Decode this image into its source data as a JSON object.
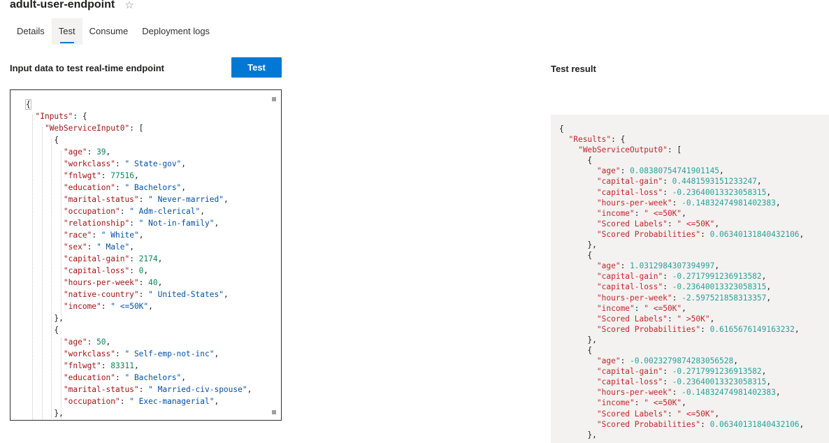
{
  "header": {
    "title": "adult-user-endpoint",
    "favorite_icon": "star-outline-icon"
  },
  "tabs": [
    {
      "label": "Details",
      "selected": false
    },
    {
      "label": "Test",
      "selected": true
    },
    {
      "label": "Consume",
      "selected": false
    },
    {
      "label": "Deployment logs",
      "selected": false
    }
  ],
  "input_section": {
    "label": "Input data to test real-time endpoint",
    "button_label": "Test"
  },
  "result_section": {
    "label": "Test result"
  },
  "input_json": {
    "root_key": "Inputs",
    "array_key": "WebServiceInput0",
    "records": [
      [
        {
          "key": "age",
          "value": "39",
          "type": "num"
        },
        {
          "key": "workclass",
          "value": " State-gov",
          "type": "str"
        },
        {
          "key": "fnlwgt",
          "value": "77516",
          "type": "num"
        },
        {
          "key": "education",
          "value": " Bachelors",
          "type": "str"
        },
        {
          "key": "marital-status",
          "value": " Never-married",
          "type": "str"
        },
        {
          "key": "occupation",
          "value": " Adm-clerical",
          "type": "str"
        },
        {
          "key": "relationship",
          "value": " Not-in-family",
          "type": "str"
        },
        {
          "key": "race",
          "value": " White",
          "type": "str"
        },
        {
          "key": "sex",
          "value": " Male",
          "type": "str"
        },
        {
          "key": "capital-gain",
          "value": "2174",
          "type": "num"
        },
        {
          "key": "capital-loss",
          "value": "0",
          "type": "num"
        },
        {
          "key": "hours-per-week",
          "value": "40",
          "type": "num"
        },
        {
          "key": "native-country",
          "value": " United-States",
          "type": "str"
        },
        {
          "key": "income",
          "value": " <=50K",
          "type": "str"
        }
      ],
      [
        {
          "key": "age",
          "value": "50",
          "type": "num"
        },
        {
          "key": "workclass",
          "value": " Self-emp-not-inc",
          "type": "str"
        },
        {
          "key": "fnlwgt",
          "value": "83311",
          "type": "num"
        },
        {
          "key": "education",
          "value": " Bachelors",
          "type": "str"
        },
        {
          "key": "marital-status",
          "value": " Married-civ-spouse",
          "type": "str"
        },
        {
          "key": "occupation",
          "value": " Exec-managerial",
          "type": "str"
        }
      ]
    ]
  },
  "result_json": {
    "root_key": "Results",
    "array_key": "WebServiceOutput0",
    "records": [
      [
        {
          "key": "age",
          "value": "0.08380754741901145",
          "type": "num"
        },
        {
          "key": "capital-gain",
          "value": "0.4481593151233247",
          "type": "num"
        },
        {
          "key": "capital-loss",
          "value": "-0.23640013323058315",
          "type": "num"
        },
        {
          "key": "hours-per-week",
          "value": "-0.14832474981402383",
          "type": "num"
        },
        {
          "key": "income",
          "value": " <=50K",
          "type": "str"
        },
        {
          "key": "Scored Labels",
          "value": " <=50K",
          "type": "str"
        },
        {
          "key": "Scored Probabilities",
          "value": "0.06340131840432106",
          "type": "num"
        }
      ],
      [
        {
          "key": "age",
          "value": "1.0312984307394997",
          "type": "num"
        },
        {
          "key": "capital-gain",
          "value": "-0.2717991236913582",
          "type": "num"
        },
        {
          "key": "capital-loss",
          "value": "-0.23640013323058315",
          "type": "num"
        },
        {
          "key": "hours-per-week",
          "value": "-2.597521858313357",
          "type": "num"
        },
        {
          "key": "income",
          "value": " <=50K",
          "type": "str"
        },
        {
          "key": "Scored Labels",
          "value": " >50K",
          "type": "str"
        },
        {
          "key": "Scored Probabilities",
          "value": "0.6165676149163232",
          "type": "num"
        }
      ],
      [
        {
          "key": "age",
          "value": "-0.0023279874283056528",
          "type": "num"
        },
        {
          "key": "capital-gain",
          "value": "-0.2717991236913582",
          "type": "num"
        },
        {
          "key": "capital-loss",
          "value": "-0.23640013323058315",
          "type": "num"
        },
        {
          "key": "hours-per-week",
          "value": "-0.14832474981402383",
          "type": "num"
        },
        {
          "key": "income",
          "value": " <=50K",
          "type": "str"
        },
        {
          "key": "Scored Labels",
          "value": " <=50K",
          "type": "str"
        },
        {
          "key": "Scored Probabilities",
          "value": "0.06340131840432106",
          "type": "num"
        }
      ]
    ]
  }
}
